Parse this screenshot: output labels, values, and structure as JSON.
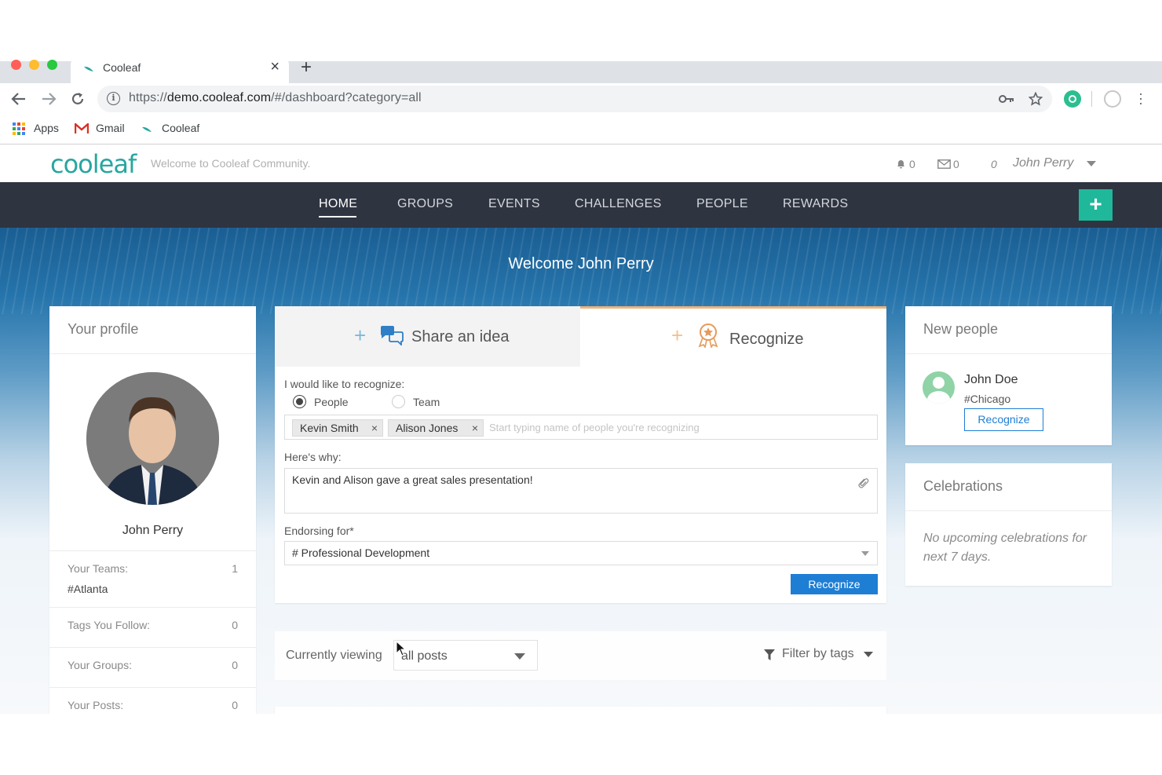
{
  "browser": {
    "tab_title": "Cooleaf",
    "url_prefix": "https://",
    "url_host": "demo.cooleaf.com",
    "url_path": "/#/dashboard?category=all",
    "bookmarks": [
      "Apps",
      "Gmail",
      "Cooleaf"
    ],
    "colors": {
      "close": "#ff5f57",
      "minimize": "#febc2e",
      "zoom": "#28c840"
    }
  },
  "app": {
    "logo_text": "cooleaf",
    "tagline": "Welcome to Cooleaf Community.",
    "notifications_count": "0",
    "messages_count": "0",
    "points": "0",
    "user_name": "John Perry",
    "accent_color": "#1fb89a"
  },
  "nav": {
    "items": [
      "HOME",
      "GROUPS",
      "EVENTS",
      "CHALLENGES",
      "PEOPLE",
      "REWARDS"
    ],
    "add_label": "+"
  },
  "hero": {
    "welcome": "Welcome John Perry"
  },
  "profile": {
    "title": "Your profile",
    "name": "John Perry",
    "teams_label": "Your Teams:",
    "teams_count": "1",
    "team_name": "#Atlanta",
    "tags_label": "Tags You Follow:",
    "tags_count": "0",
    "groups_label": "Your Groups:",
    "groups_count": "0",
    "posts_label": "Your Posts:",
    "posts_count": "0"
  },
  "composer": {
    "share_tab": "Share an idea",
    "recognize_tab": "Recognize",
    "recognize_prompt": "I would like to recognize:",
    "radio_people": "People",
    "radio_team": "Team",
    "recipients": [
      "Kevin Smith",
      "Alison Jones"
    ],
    "recipient_placeholder": "Start typing name of people you're recognizing",
    "why_label": "Here's why:",
    "why_value": "Kevin and Alison gave a great sales presentation!",
    "endorse_label": "Endorsing for*",
    "endorse_value": "# Professional Development",
    "submit_label": "Recognize"
  },
  "feed": {
    "viewing_label": "Currently viewing",
    "viewing_value": "all posts",
    "filter_label": "Filter by tags"
  },
  "new_people": {
    "title": "New people",
    "person_name": "John Doe",
    "person_team": "#Chicago",
    "button": "Recognize"
  },
  "celebrations": {
    "title": "Celebrations",
    "empty_text": "No upcoming celebrations for next 7 days."
  }
}
